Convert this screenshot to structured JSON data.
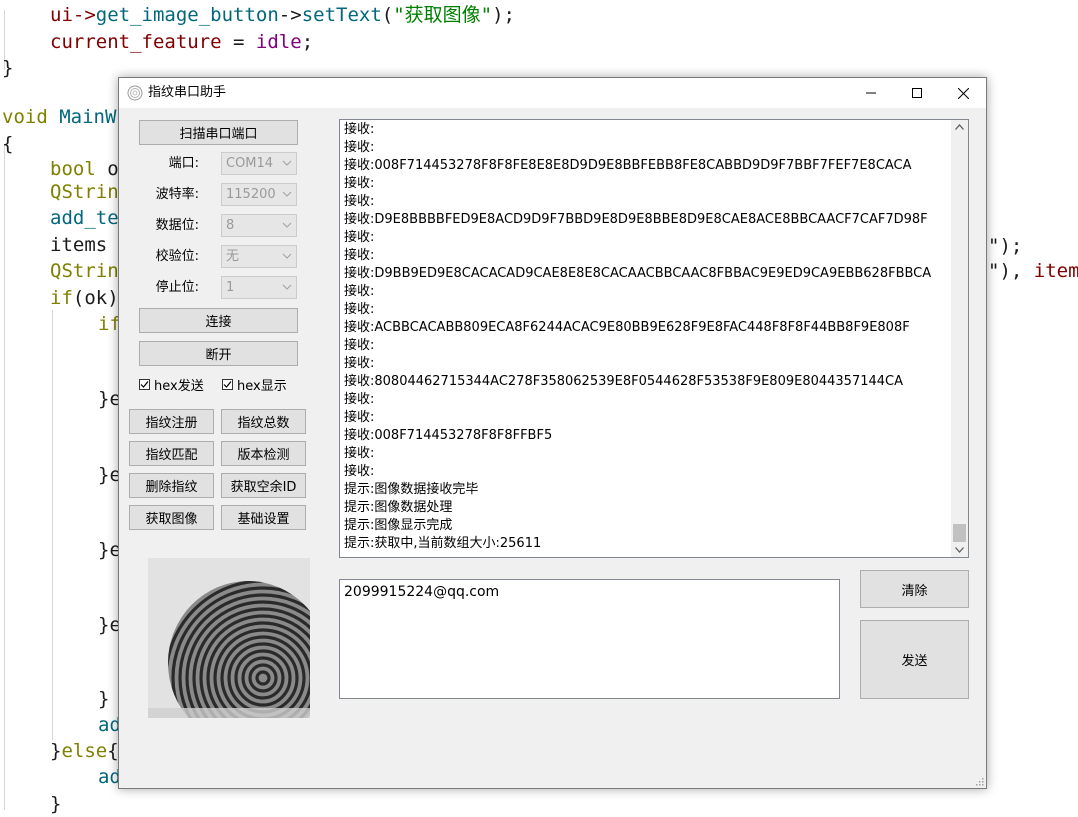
{
  "editor": {
    "lines": {
      "l1": [
        "ui->",
        "get_image_button",
        "->",
        "setText",
        "(",
        "\"获取图像\"",
        ");"
      ],
      "l2": [
        "current_feature",
        " = ",
        "idle",
        ";"
      ],
      "l3": "}",
      "l4": [
        "void",
        " MainW"
      ],
      "l5": "{",
      "l6": [
        "bool",
        " o"
      ],
      "l7": "QStrin",
      "l8": "add_te",
      "l9": "items ",
      "l10": "QStrin",
      "l11": [
        "if",
        "(ok)"
      ],
      "l12": "if",
      "l14": "}e",
      "l17": "}e",
      "l20": "}e",
      "l23": "}e",
      "l26": "}",
      "l27": "ad",
      "l28": [
        "}",
        "else",
        "{"
      ],
      "l29": "ad",
      "l30": "}",
      "r9": "\");",
      "r10": [
        "\"), ",
        "items"
      ]
    }
  },
  "window": {
    "title": "指纹串口助手",
    "controls": {
      "minimize": "minimize-icon",
      "maximize": "maximize-icon",
      "close": "close-icon"
    }
  },
  "serial": {
    "scan_button": "扫描串口端口",
    "port_label": "端口:",
    "port_value": "COM14",
    "baud_label": "波特率:",
    "baud_value": "115200",
    "data_bits_label": "数据位:",
    "data_bits_value": "8",
    "parity_label": "校验位:",
    "parity_value": "无",
    "stop_bits_label": "停止位:",
    "stop_bits_value": "1",
    "connect_button": "连接",
    "disconnect_button": "断开",
    "hex_send_label": "hex发送",
    "hex_send_checked": true,
    "hex_display_label": "hex显示",
    "hex_display_checked": true
  },
  "actions": {
    "enroll": "指纹注册",
    "total": "指纹总数",
    "match": "指纹匹配",
    "version": "版本检测",
    "delete": "删除指纹",
    "free_id": "获取空余ID",
    "get_image": "获取图像",
    "settings": "基础设置"
  },
  "receive_log": [
    "接收:",
    "接收:",
    "接收:008F714453278F8F8FE8E8E8D9D9E8BBFEBB8FE8CABBD9D9F7BBF7FEF7E8CACA",
    "接收:",
    "接收:",
    "接收:D9E8BBBBFED9E8ACD9D9F7BBD9E8D9E8BBE8D9E8CAE8ACE8BBCAACF7CAF7D98F",
    "接收:",
    "接收:",
    "接收:D9BB9ED9E8CACACAD9CAE8E8E8CACAACBBCAAC8FBBAC9E9ED9CA9EBB628FBBCA",
    "接收:",
    "接收:",
    "接收:ACBBCACABB809ECA8F6244ACAC9E80BB9E628F9E8FAC448F8F8F44BB8F9E808F",
    "接收:",
    "接收:",
    "接收:80804462715344AC278F358062539E8F0544628F53538F9E809E8044357144CA",
    "接收:",
    "接收:",
    "接收:008F714453278F8F8FFBF5",
    "接收:",
    "接收:",
    "提示:图像数据接收完毕",
    "提示:图像数据处理",
    "提示:图像显示完成",
    "提示:获取中,当前数组大小:25611"
  ],
  "send": {
    "text": "2099915224@qq.com",
    "clear_button": "清除",
    "send_button": "发送"
  }
}
